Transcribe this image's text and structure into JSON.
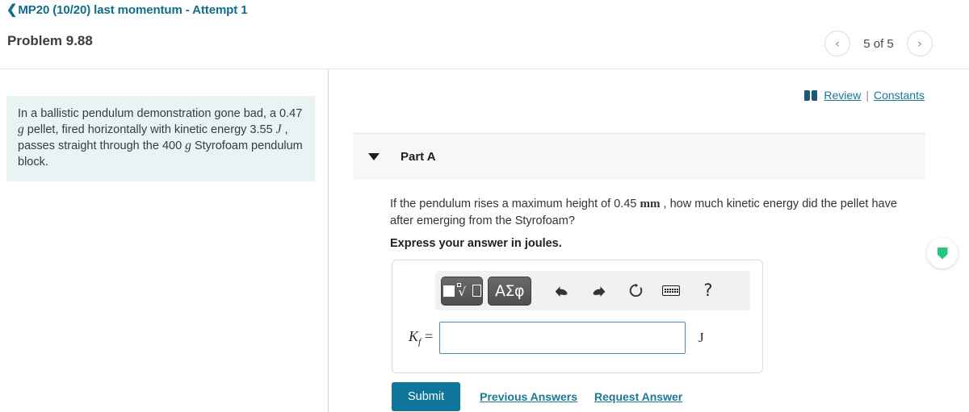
{
  "header": {
    "back_icon": "chevron-left-icon",
    "breadcrumb": "MP20 (10/20) last momentum - Attempt 1",
    "problem_title": "Problem 9.88",
    "pager": {
      "prev_label": "‹",
      "next_label": "›",
      "count_text": "5 of 5"
    }
  },
  "left": {
    "statement_part1": "In a ballistic pendulum demonstration gone bad, a 0.47",
    "statement_unit1": "g",
    "statement_part2": "pellet, fired horizontally with kinetic energy 3.55",
    "statement_unit2": "J",
    "statement_part3": ", passes straight through the 400",
    "statement_unit3": "g",
    "statement_part4": "Styrofoam pendulum block."
  },
  "right": {
    "review_link": "Review",
    "links_separator": "|",
    "constants_link": "Constants",
    "book_icon": "book-icon",
    "part_label": "Part A",
    "question_part1": "If the pendulum rises a maximum height of 0.45",
    "question_unit": "mm",
    "question_part2": ", how much kinetic energy did the pellet have after emerging from the Styrofoam?",
    "express_line": "Express your answer in joules.",
    "toolbar": {
      "template_button": "math-template-button",
      "greek_button": "ΑΣφ",
      "undo_icon": "⬅",
      "redo_icon": "➡",
      "refresh_icon": "↻",
      "keyboard_icon": "keyboard-icon",
      "help_icon": "?"
    },
    "answer": {
      "variable": "K",
      "variable_sub": "f",
      "equals": "=",
      "input_value": "",
      "input_placeholder": "",
      "unit": "J"
    },
    "submit_label": "Submit",
    "previous_answers_label": "Previous Answers",
    "request_answer_label": "Request Answer"
  },
  "fab": {
    "icon": "shield-icon"
  },
  "colors": {
    "accent_teal": "#10759a",
    "link_blue": "#1b7795",
    "statement_bg": "#e8f4f4",
    "panel_bg": "#f7f7f8",
    "input_border": "#4a90ad",
    "shield_green": "#23c87d"
  }
}
